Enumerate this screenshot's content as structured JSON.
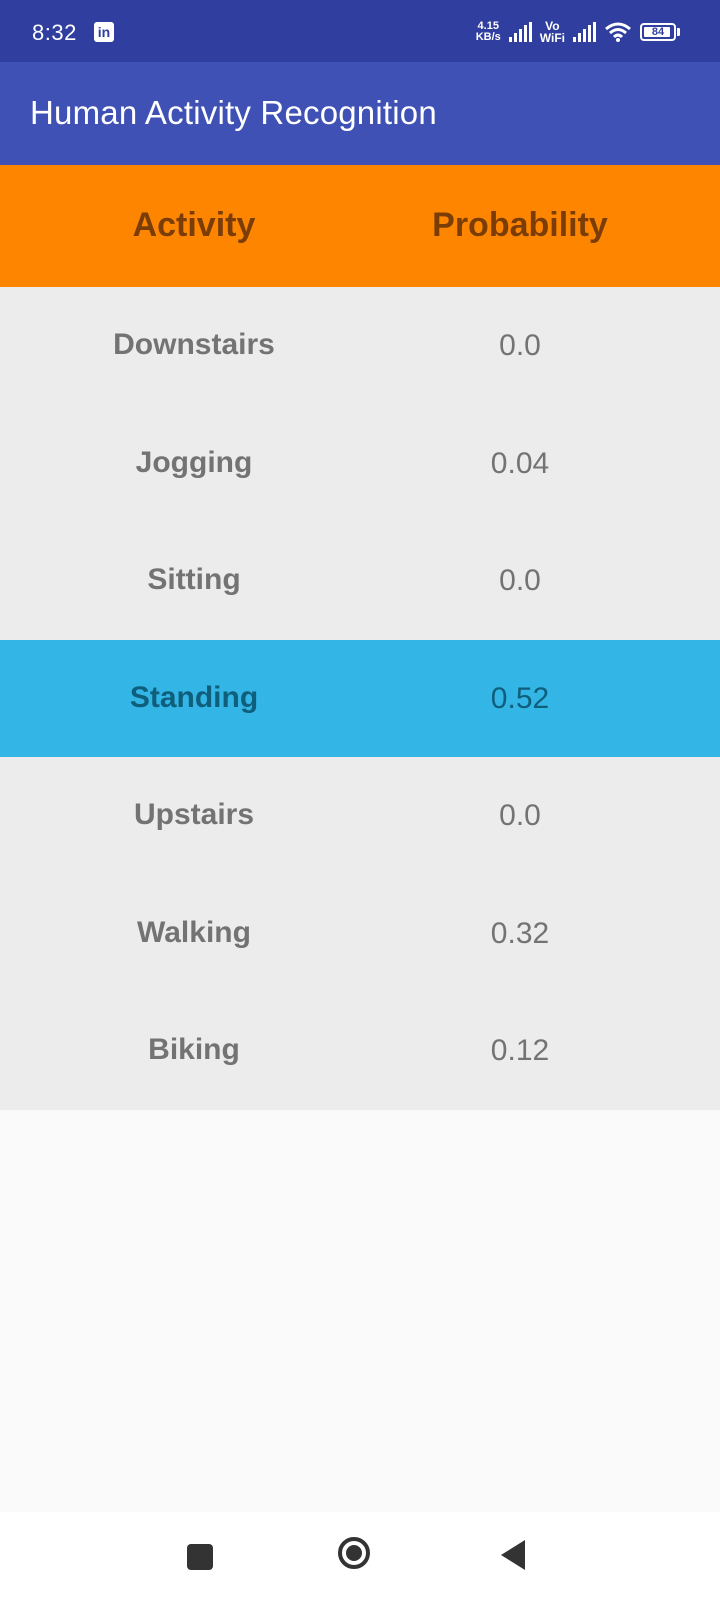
{
  "status_bar": {
    "time": "8:32",
    "app_icon": "linkedin-icon",
    "net_speed_value": "4.15",
    "net_speed_unit": "KB/s",
    "vo_top": "Vo",
    "vo_bottom": "WiFi",
    "battery_level": "84",
    "color": "#303f9f"
  },
  "app_bar": {
    "title": "Human Activity Recognition",
    "color": "#3f51b5"
  },
  "table": {
    "headers": {
      "activity": "Activity",
      "probability": "Probability"
    },
    "header_color": "#fe8500",
    "highlight_color": "#33b5e5",
    "rows": [
      {
        "activity": "Downstairs",
        "probability": "0.0"
      },
      {
        "activity": "Jogging",
        "probability": "0.04"
      },
      {
        "activity": "Sitting",
        "probability": "0.0"
      },
      {
        "activity": "Standing",
        "probability": "0.52"
      },
      {
        "activity": "Upstairs",
        "probability": "0.0"
      },
      {
        "activity": "Walking",
        "probability": "0.32"
      },
      {
        "activity": "Biking",
        "probability": "0.12"
      }
    ]
  },
  "nav_bar": {
    "recent_icon": "square-recent-apps-icon",
    "home_icon": "circle-home-icon",
    "back_icon": "triangle-back-icon"
  }
}
